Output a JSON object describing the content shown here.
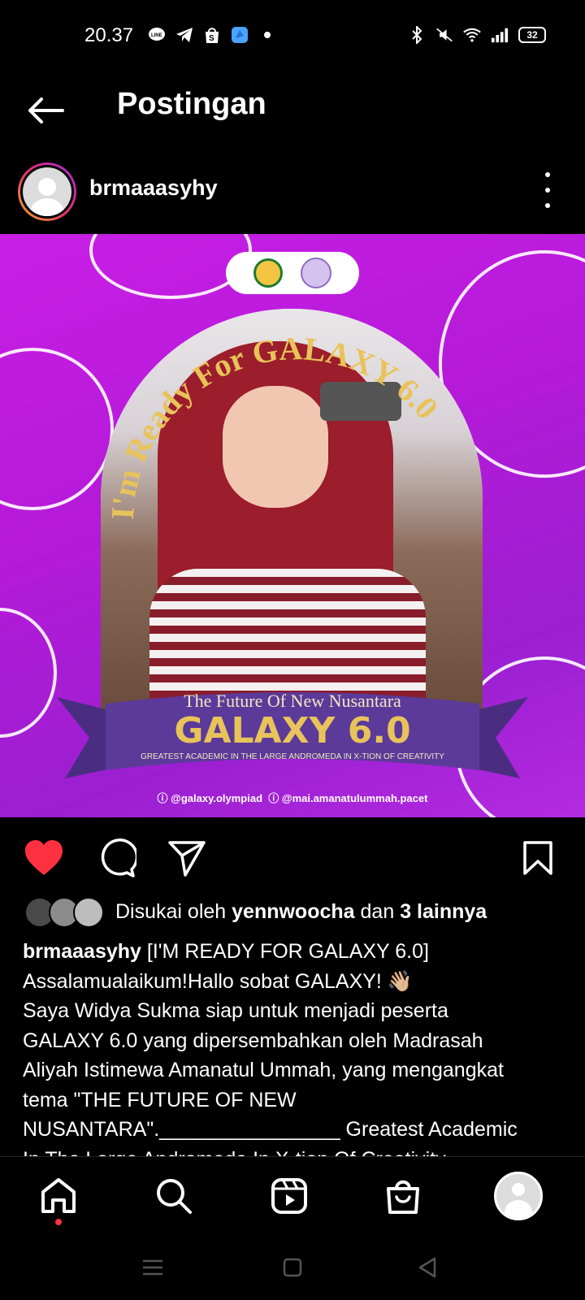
{
  "status_bar": {
    "time": "20.37",
    "battery": "32",
    "left_icons": [
      "line-icon",
      "telegram-icon",
      "shopee-icon",
      "app-icon",
      "dot-icon"
    ],
    "right_icons": [
      "bluetooth-icon",
      "mute-icon",
      "wifi-icon",
      "signal-icon",
      "battery-icon"
    ]
  },
  "header": {
    "title": "Postingan",
    "back_icon": "back-arrow-icon"
  },
  "post": {
    "username": "brmaaasyhy",
    "image": {
      "arch_text": "I'm Ready For GALAXY 6.0",
      "subtitle": "The Future Of New Nusantara",
      "headline": "GALAXY 6.0",
      "tagline": "GREATEST ACADEMIC IN THE LARGE ANDROMEDA IN X-TION OF CREATIVITY",
      "social_1": "@galaxy.olympiad",
      "social_2": "@mai.amanatulummah.pacet"
    },
    "liked": true,
    "likes": {
      "prefix": "Disukai oleh",
      "user": "yennwoocha",
      "joiner": "dan",
      "others": "3 lainnya"
    },
    "caption": {
      "username": "brmaaasyhy",
      "line1": "[I'M READY FOR GALAXY 6.0]",
      "line2": "Assalamualaikum!Hallo sobat GALAXY! 👋🏼",
      "line3": "Saya Widya Sukma siap untuk menjadi peserta",
      "line4": "GALAXY 6.0 yang dipersembahkan oleh Madrasah",
      "line5": "Aliyah Istimewa Amanatul Ummah, yang mengangkat",
      "line6": "tema \"THE FUTURE OF NEW",
      "line7": "NUSANTARA\".________________ Greatest Academic",
      "line8": "In The Large Andromeda In X-tion Of Creativity. ..."
    }
  },
  "colors": {
    "heart": "#ff3040",
    "background": "#000000",
    "poster_purple": "#b51ad8",
    "ribbon": "#5b3a9a",
    "gold": "#e8c35a"
  }
}
